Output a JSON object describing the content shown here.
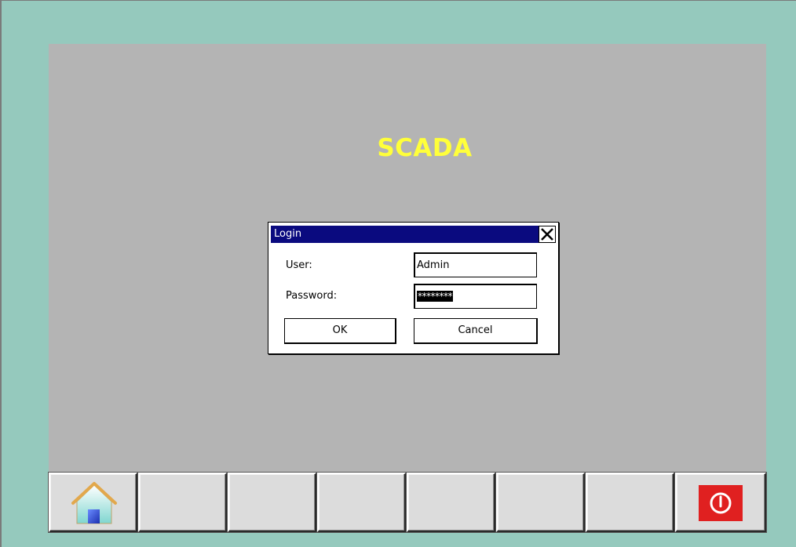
{
  "app": {
    "title": "SCADA"
  },
  "login_dialog": {
    "title": "Login",
    "user_label": "User:",
    "user_value": "Admin",
    "password_label": "Password:",
    "password_value": "********",
    "ok_label": "OK",
    "cancel_label": "Cancel",
    "close_icon": "close-icon"
  },
  "toolbar": {
    "buttons": [
      {
        "name": "home",
        "icon": "home-icon"
      },
      {
        "name": "empty-1",
        "icon": ""
      },
      {
        "name": "empty-2",
        "icon": ""
      },
      {
        "name": "empty-3",
        "icon": ""
      },
      {
        "name": "empty-4",
        "icon": ""
      },
      {
        "name": "empty-5",
        "icon": ""
      },
      {
        "name": "empty-6",
        "icon": ""
      },
      {
        "name": "power",
        "icon": "power-icon"
      }
    ]
  },
  "colors": {
    "frame_background": "#95c9bd",
    "screen_background": "#b4b4b4",
    "title_color": "#ffff3a",
    "titlebar": "#0a0a7f",
    "power_button": "#e02020"
  }
}
